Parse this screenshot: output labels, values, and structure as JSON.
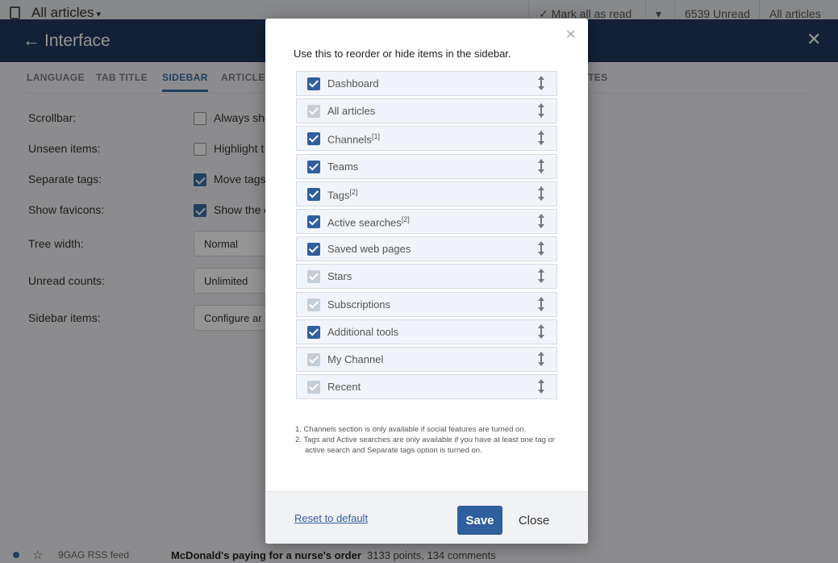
{
  "topbar": {
    "app_title": "All articles",
    "mark_all_read": "Mark all as read",
    "unread_count": "6539 Unread",
    "filter": "All articles"
  },
  "panel": {
    "title": "Interface",
    "tabs": [
      "LANGUAGE",
      "TAB TITLE",
      "SIDEBAR",
      "ARTICLE",
      "TES"
    ],
    "active_tab": "SIDEBAR"
  },
  "settings": [
    {
      "label": "Scrollbar:",
      "text": "Always sho",
      "checked": false
    },
    {
      "label": "Unseen items:",
      "text": "Highlight t",
      "checked": false
    },
    {
      "label": "Separate tags:",
      "text": "Move tags",
      "checked": true
    },
    {
      "label": "Show favicons:",
      "text": "Show the c",
      "checked": true
    },
    {
      "label": "Tree width:",
      "select": "Normal"
    },
    {
      "label": "Unread counts:",
      "select": "Unlimited"
    },
    {
      "label": "Sidebar items:",
      "select": "Configure ar"
    }
  ],
  "article_row": {
    "feed": "9GAG RSS feed",
    "headline": "McDonald's paying for a nurse's order",
    "meta": "3133 points, 134 comments"
  },
  "modal": {
    "intro": "Use this to reorder or hide items in the sidebar.",
    "items": [
      {
        "label": "Dashboard",
        "sup": "",
        "checked": true,
        "locked": false
      },
      {
        "label": "All articles",
        "sup": "",
        "checked": true,
        "locked": true
      },
      {
        "label": "Channels",
        "sup": "[1]",
        "checked": true,
        "locked": false
      },
      {
        "label": "Teams",
        "sup": "",
        "checked": true,
        "locked": false
      },
      {
        "label": "Tags",
        "sup": "[2]",
        "checked": true,
        "locked": false
      },
      {
        "label": "Active searches",
        "sup": "[2]",
        "checked": true,
        "locked": false
      },
      {
        "label": "Saved web pages",
        "sup": "",
        "checked": true,
        "locked": false
      },
      {
        "label": "Stars",
        "sup": "",
        "checked": true,
        "locked": true
      },
      {
        "label": "Subscriptions",
        "sup": "",
        "checked": true,
        "locked": true
      },
      {
        "label": "Additional tools",
        "sup": "",
        "checked": true,
        "locked": false
      },
      {
        "label": "My Channel",
        "sup": "",
        "checked": true,
        "locked": true
      },
      {
        "label": "Recent",
        "sup": "",
        "checked": true,
        "locked": true
      }
    ],
    "footnotes": [
      "1. Channels section is only available if social features are turned on.",
      "2. Tags and Active searches are only available if you have at least one tag or active search and Separate tags option is turned on."
    ],
    "reset_label": "Reset to default",
    "save_label": "Save",
    "close_label": "Close"
  },
  "colors": {
    "header_bg": "#1f3a60",
    "accent": "#2f5f9e",
    "checkbox_dim": "#c3ced9"
  }
}
